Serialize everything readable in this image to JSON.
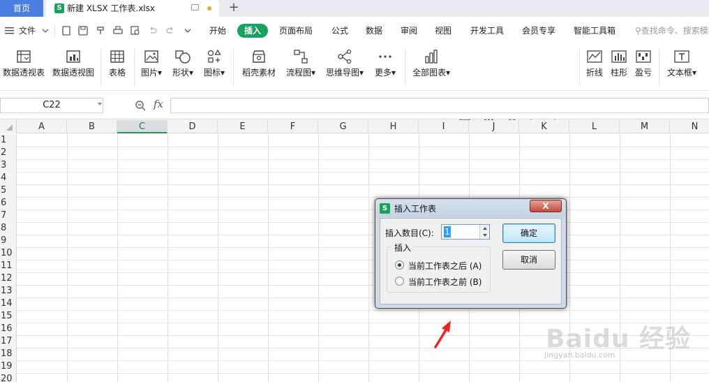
{
  "tabs": {
    "home_label": "首页",
    "document_title": "新建 XLSX 工作表.xlsx",
    "add_tab_icon": "plus-icon"
  },
  "menubar": {
    "file_label": "文件",
    "ribbon_tabs": [
      "开始",
      "插入",
      "页面布局",
      "公式",
      "数据",
      "审阅",
      "视图",
      "开发工具",
      "会员专享",
      "智能工具箱"
    ],
    "active_tab": "插入",
    "search_placeholder": "查找命令、搜索模板"
  },
  "ribbon": {
    "items": [
      {
        "label": "数据透视表",
        "icon": "pivot-table-icon"
      },
      {
        "label": "数据透视图",
        "icon": "pivot-chart-icon"
      },
      {
        "label": "表格",
        "icon": "table-icon"
      },
      {
        "label": "图片",
        "icon": "image-icon"
      },
      {
        "label": "形状",
        "icon": "shapes-icon"
      },
      {
        "label": "图标",
        "icon": "icons-icon"
      },
      {
        "label": "稻壳素材",
        "icon": "docer-material-icon"
      },
      {
        "label": "流程图",
        "icon": "flowchart-icon"
      },
      {
        "label": "思维导图",
        "icon": "mindmap-icon"
      },
      {
        "label": "更多",
        "icon": "more-icon"
      },
      {
        "label": "全部图表",
        "icon": "all-charts-icon"
      },
      {
        "label": "折线",
        "icon": "sparkline-line-icon"
      },
      {
        "label": "柱形",
        "icon": "sparkline-column-icon"
      },
      {
        "label": "盈亏",
        "icon": "sparkline-winloss-icon"
      },
      {
        "label": "文本框",
        "icon": "textbox-icon"
      }
    ]
  },
  "formula_bar": {
    "name_box": "C22",
    "fx_label": "fx",
    "formula_value": ""
  },
  "sheet": {
    "columns": [
      "A",
      "B",
      "C",
      "D",
      "E",
      "F",
      "G",
      "H",
      "I",
      "J",
      "K",
      "L",
      "M",
      "N"
    ],
    "selected_column": "C",
    "rows": [
      "1",
      "2",
      "3",
      "4",
      "5",
      "6",
      "7",
      "8",
      "9",
      "10",
      "11",
      "12",
      "13",
      "14",
      "15",
      "16",
      "17",
      "18",
      "19",
      "20"
    ]
  },
  "dialog": {
    "title": "插入工作表",
    "close_label": "X",
    "count_label": "插入数目(C):",
    "count_value": "1",
    "group_label": "插入",
    "option_after": "当前工作表之后 (A)",
    "option_before": "当前工作表之前 (B)",
    "selected_option": "after",
    "ok_label": "确定",
    "cancel_label": "取消"
  },
  "watermark": {
    "text": "Baidu 经验",
    "url": "jingyan.baidu.com"
  },
  "colors": {
    "accent_green": "#15a35d",
    "home_tab_blue": "#4a7fe0",
    "arrow_red": "#e8251e"
  }
}
